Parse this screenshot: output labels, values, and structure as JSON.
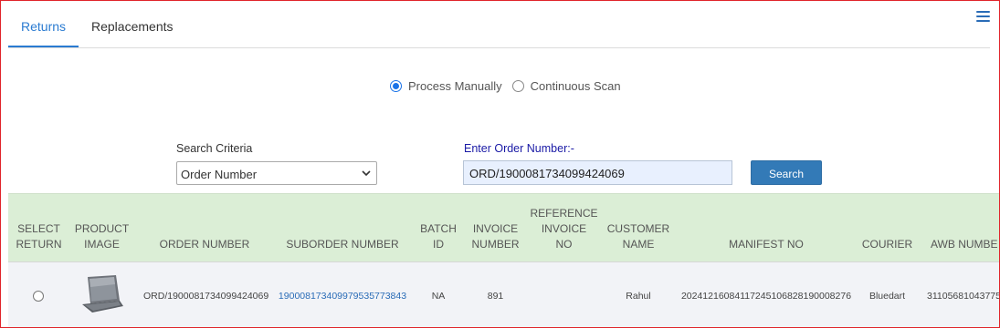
{
  "tabs": [
    {
      "label": "Returns",
      "active": true
    },
    {
      "label": "Replacements",
      "active": false
    }
  ],
  "mode": {
    "options": [
      "Process Manually",
      "Continuous Scan"
    ],
    "selected": "Process Manually"
  },
  "search": {
    "criteria_label": "Search Criteria",
    "criteria_value": "Order Number",
    "order_label": "Enter Order Number:-",
    "order_value": "ORD/1900081734099424069",
    "button_label": "Search"
  },
  "table": {
    "headers": {
      "select_return": [
        "SELECT",
        "RETURN"
      ],
      "product_image": [
        "PRODUCT",
        "IMAGE"
      ],
      "order_number": [
        "ORDER NUMBER"
      ],
      "suborder_number": [
        "SUBORDER NUMBER"
      ],
      "batch_id": [
        "BATCH",
        "ID"
      ],
      "invoice_number": [
        "INVOICE",
        "NUMBER"
      ],
      "reference_invoice_no": [
        "REFERENCE",
        "INVOICE",
        "NO"
      ],
      "customer_name": [
        "CUSTOMER",
        "NAME"
      ],
      "manifest_no": [
        "MANIFEST NO"
      ],
      "courier": [
        "COURIER"
      ],
      "awb_number": [
        "AWB NUMBE"
      ]
    },
    "rows": [
      {
        "product_icon": "laptop-image",
        "order_number": "ORD/1900081734099424069",
        "suborder_number": "1900081734099795357738 43",
        "suborder_display": "1900081734099795357738​43",
        "batch_id": "NA",
        "invoice_number": "891",
        "reference_invoice_no": "",
        "customer_name": "Rahul",
        "manifest_no": "20241216084117245106828190008276",
        "courier": "Bluedart",
        "awb_number": "31105681043775"
      }
    ]
  },
  "colors": {
    "accent": "#2a7bd1",
    "header_bg": "#dbeed6",
    "button_bg": "#337ab7",
    "frame_border": "#e0242a"
  }
}
